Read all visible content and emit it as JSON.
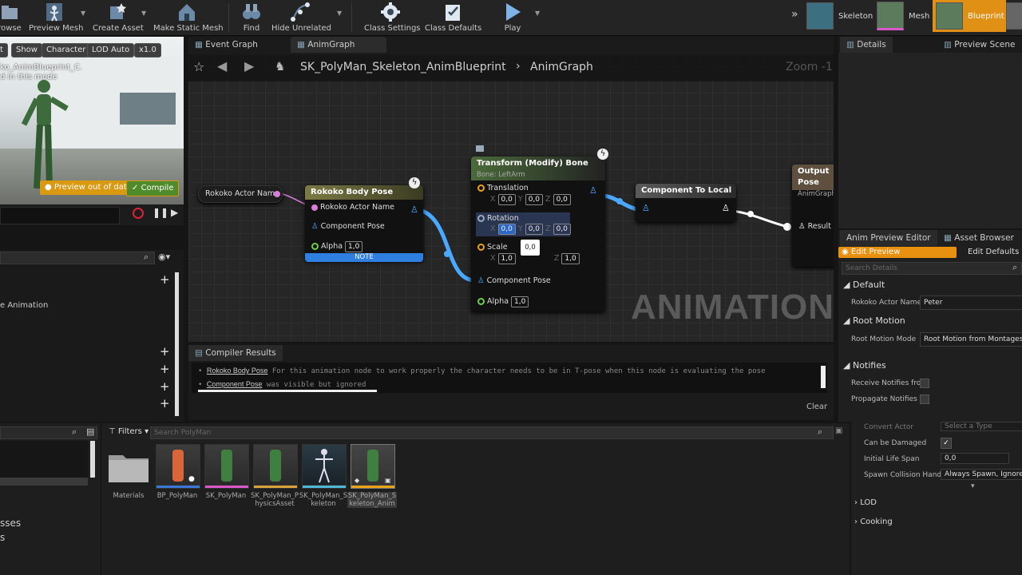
{
  "toolbar": {
    "browse": "rowse",
    "preview_mesh": "Preview Mesh",
    "create_asset": "Create Asset",
    "make_static_mesh": "Make Static Mesh",
    "find": "Find",
    "hide_unrelated": "Hide Unrelated",
    "class_settings": "Class Settings",
    "class_defaults": "Class Defaults",
    "play": "Play",
    "modes": [
      "Skeleton",
      "Mesh",
      "Blueprint"
    ]
  },
  "viewport": {
    "chips": [
      "Show",
      "Character",
      "LOD Auto",
      "x1.0"
    ],
    "overlay_line1": "ko_AnimBlueprint_C.",
    "overlay_line2": "d in this mode",
    "preview_out_of_date": "Preview out of date",
    "compile": "Compile"
  },
  "left_panel": {
    "item_animation": "e Animation",
    "bottom_text1": "sses",
    "bottom_text2": "s"
  },
  "graph_tabs": {
    "event_graph": "Event Graph",
    "anim_graph": "AnimGraph"
  },
  "breadcrumb": {
    "blueprint": "SK_PolyMan_Skeleton_AnimBlueprint",
    "graph": "AnimGraph",
    "zoom": "Zoom -1"
  },
  "nodes": {
    "actor_name_var": "Rokoko Actor Name",
    "body_pose": {
      "title": "Rokoko Body Pose",
      "pin_actor": "Rokoko Actor Name",
      "pin_pose": "Component Pose",
      "pin_alpha": "Alpha",
      "alpha": "1,0",
      "note": "NOTE"
    },
    "transform": {
      "title": "Transform (Modify) Bone",
      "subtitle": "Bone: LeftArm",
      "translation": "Translation",
      "t": [
        "0,0",
        "0,0",
        "0,0"
      ],
      "rotation": "Rotation",
      "r": [
        "0,0",
        "0,0",
        "0,0"
      ],
      "tooltip": "0,0",
      "scale": "Scale",
      "s": [
        "1,0",
        "",
        "1,0"
      ],
      "pin_pose": "Component Pose",
      "pin_alpha": "Alpha",
      "alpha": "1,0"
    },
    "comp_to_local": "Component To Local",
    "output_pose": "Output Pose",
    "output_sub": "AnimGraph",
    "result": "Result",
    "watermark": "ANIMATION"
  },
  "compiler": {
    "tab": "Compiler Results",
    "line1_link": "Rokoko Body Pose",
    "line1_text": "For this animation node to work properly the character needs to be in T-pose when this node is evaluating the pose",
    "line2_link": "Component Pose",
    "line2_text": "was visible but ignored",
    "clear": "Clear"
  },
  "details": {
    "tab_details": "Details",
    "tab_preview": "Preview Scene Set",
    "tab_anim_preview": "Anim Preview Editor",
    "tab_asset_browser": "Asset Browser",
    "edit_preview": "Edit Preview",
    "edit_defaults": "Edit Defaults",
    "search_placeholder": "Search Details",
    "sec_default": "Default",
    "actor_name_label": "Rokoko Actor Name",
    "actor_name_value": "Peter",
    "sec_root_motion": "Root Motion",
    "root_motion_label": "Root Motion Mode",
    "root_motion_value": "Root Motion from Montages O",
    "sec_notifies": "Notifies",
    "receive_notifies": "Receive Notifies fro",
    "propagate_notifies": "Propagate Notifies t"
  },
  "actor_props": {
    "convert_actor": "Convert Actor",
    "convert_value": "Select a Type",
    "can_be_damaged": "Can be Damaged",
    "initial_life_span": "Initial Life Span",
    "life_span_value": "0,0",
    "spawn_collision": "Spawn Collision Handli",
    "spawn_value": "Always Spawn, Ignore C",
    "lod": "LOD",
    "cooking": "Cooking"
  },
  "content": {
    "filters": "Filters",
    "search_placeholder": "Search PolyMan",
    "assets": [
      "Materials",
      "BP_PolyMan",
      "SK_PolyMan",
      "SK_PolyMan_PhysicsAsset",
      "SK_PolyMan_Skeleton",
      "SK_PolyMan_Skeleton_Anim"
    ]
  },
  "colors": {
    "accent": "#e8a317",
    "compile": "#4f8a2b",
    "wire": "#4aa8ff",
    "note": "#2e7fe0"
  }
}
